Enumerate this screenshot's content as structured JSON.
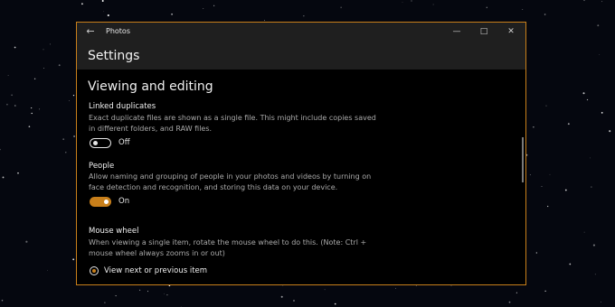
{
  "window": {
    "title": "Photos",
    "icons": {
      "back": "back-arrow-icon",
      "minimize": "minimize-icon",
      "maximize": "maximize-icon",
      "close": "close-icon"
    }
  },
  "header": {
    "title": "Settings"
  },
  "section": {
    "title": "Viewing and editing"
  },
  "settings": {
    "linked_duplicates": {
      "label": "Linked duplicates",
      "description": "Exact duplicate files are shown as a single file. This might include copies saved in different folders, and RAW files.",
      "state": "Off"
    },
    "people": {
      "label": "People",
      "description": "Allow naming and grouping of people in your photos and videos by turning on face detection and recognition, and storing this data on your device.",
      "state": "On"
    },
    "mouse_wheel": {
      "label": "Mouse wheel",
      "description": "When viewing a single item, rotate the mouse wheel to do this. (Note: Ctrl + mouse wheel always zooms in or out)",
      "option": "View next or previous item"
    }
  },
  "colors": {
    "accent": "#c87f1a",
    "background": "#000000",
    "titlebar": "#1f1f1f"
  }
}
